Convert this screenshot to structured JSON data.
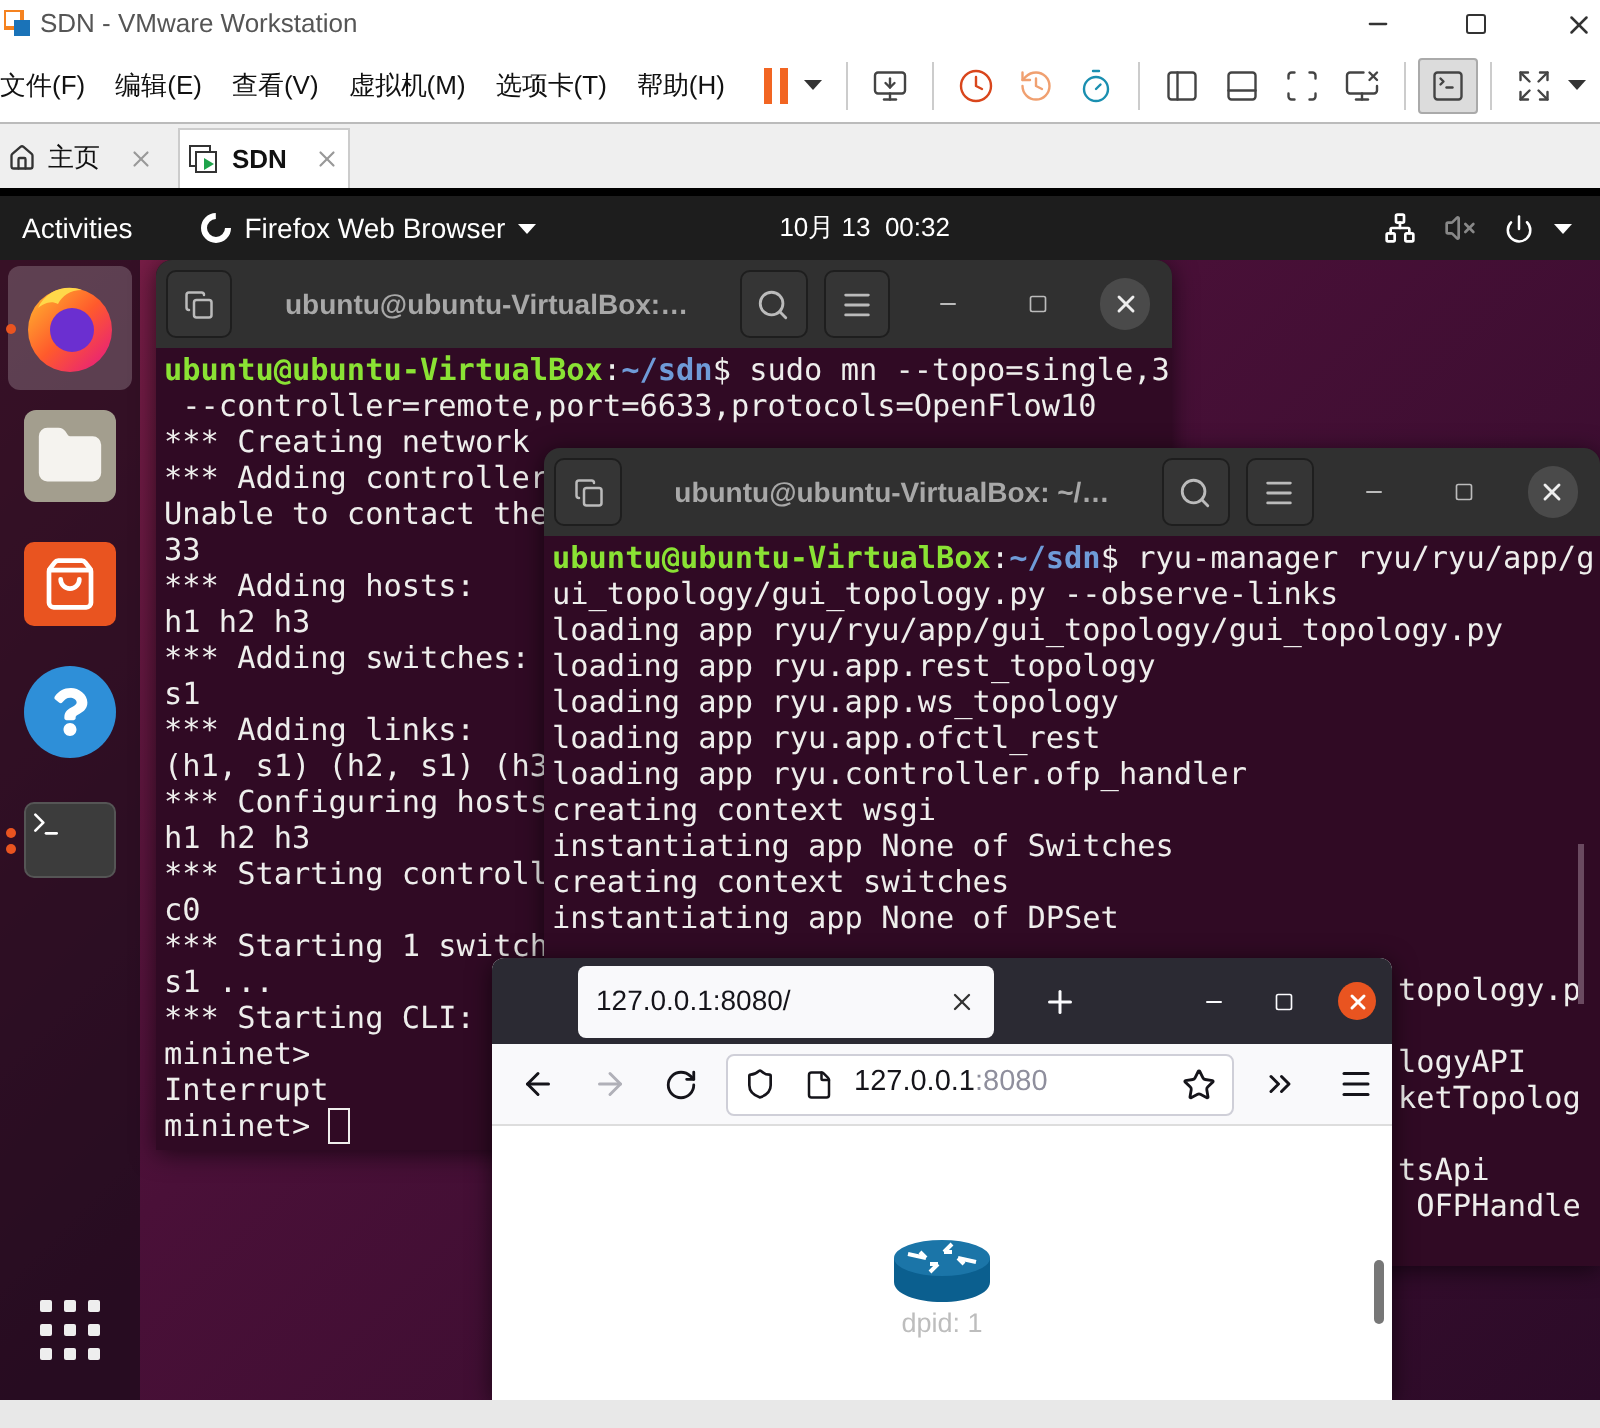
{
  "vmware": {
    "title": "SDN - VMware Workstation",
    "menu": [
      "文件(F)",
      "编辑(E)",
      "查看(V)",
      "虚拟机(M)",
      "选项卡(T)",
      "帮助(H)"
    ],
    "toolbar": [
      {
        "kind": "pause",
        "selected": false
      },
      {
        "kind": "send-keys",
        "selected": false
      },
      {
        "kind": "snapshot-take",
        "selected": false
      },
      {
        "kind": "snapshot-revert",
        "selected": false
      },
      {
        "kind": "snapshot-manager",
        "selected": false
      },
      {
        "kind": "library",
        "selected": false
      },
      {
        "kind": "thumbnails",
        "selected": false
      },
      {
        "kind": "full-screen",
        "selected": false
      },
      {
        "kind": "unity",
        "selected": false
      },
      {
        "kind": "console",
        "selected": true
      },
      {
        "kind": "stretch",
        "selected": false
      }
    ],
    "tabs": [
      {
        "label": "主页",
        "kind": "home",
        "selected": false
      },
      {
        "label": "SDN",
        "kind": "vm",
        "selected": true
      }
    ]
  },
  "ubuntu": {
    "activities": "Activities",
    "app_menu": "Firefox Web Browser",
    "clock": "10月 13  00:32",
    "sound_muted": true
  },
  "dock": [
    {
      "kind": "browser",
      "selected": true,
      "running": true,
      "multiple_windows": false
    },
    {
      "kind": "files",
      "selected": false,
      "running": false
    },
    {
      "kind": "software",
      "selected": false,
      "running": false
    },
    {
      "kind": "help",
      "selected": false,
      "running": false
    },
    {
      "kind": "terminal",
      "selected": false,
      "running": true,
      "multiple_windows": true
    }
  ],
  "terminals": [
    {
      "title": "ubuntu@ubuntu-VirtualBox:…",
      "cursor": true,
      "lines": [
        {
          "kind": "prompt",
          "segments": [
            {
              "kind": "user",
              "text": "ubuntu@ubuntu-VirtualBox"
            },
            {
              "kind": "plain",
              "text": ":"
            },
            {
              "kind": "path",
              "text": "~/sdn"
            },
            {
              "kind": "plain",
              "text": "$ sudo mn --topo=single,3"
            }
          ]
        },
        {
          "kind": "output",
          "text": " --controller=remote,port=6633,protocols=OpenFlow10"
        },
        {
          "kind": "output",
          "text": "*** Creating network"
        },
        {
          "kind": "output",
          "text": "*** Adding controller"
        },
        {
          "kind": "output",
          "text": "Unable to contact the"
        },
        {
          "kind": "output",
          "text": "33"
        },
        {
          "kind": "output",
          "text": "*** Adding hosts:"
        },
        {
          "kind": "output",
          "text": "h1 h2 h3"
        },
        {
          "kind": "output",
          "text": "*** Adding switches:"
        },
        {
          "kind": "output",
          "text": "s1"
        },
        {
          "kind": "output",
          "text": "*** Adding links:"
        },
        {
          "kind": "output",
          "text": "(h1, s1) (h2, s1) (h3"
        },
        {
          "kind": "output",
          "text": "*** Configuring hosts"
        },
        {
          "kind": "output",
          "text": "h1 h2 h3"
        },
        {
          "kind": "output",
          "text": "*** Starting controll"
        },
        {
          "kind": "output",
          "text": "c0"
        },
        {
          "kind": "output",
          "text": "*** Starting 1 switch"
        },
        {
          "kind": "output",
          "text": "s1 ..."
        },
        {
          "kind": "output",
          "text": "*** Starting CLI:"
        },
        {
          "kind": "output",
          "text": "mininet>"
        },
        {
          "kind": "output",
          "text": "Interrupt"
        },
        {
          "kind": "output",
          "text": "mininet>"
        }
      ]
    },
    {
      "title": "ubuntu@ubuntu-VirtualBox: ~/…",
      "cursor": false,
      "lines": [
        {
          "kind": "prompt",
          "segments": [
            {
              "kind": "user",
              "text": "ubuntu@ubuntu-VirtualBox"
            },
            {
              "kind": "plain",
              "text": ":"
            },
            {
              "kind": "path",
              "text": "~/sdn"
            },
            {
              "kind": "plain",
              "text": "$ ryu-manager ryu/ryu/app/g"
            }
          ]
        },
        {
          "kind": "output",
          "text": "ui_topology/gui_topology.py --observe-links"
        },
        {
          "kind": "output",
          "text": "loading app ryu/ryu/app/gui_topology/gui_topology.py"
        },
        {
          "kind": "output",
          "text": "loading app ryu.app.rest_topology"
        },
        {
          "kind": "output",
          "text": "loading app ryu.app.ws_topology"
        },
        {
          "kind": "output",
          "text": "loading app ryu.app.ofctl_rest"
        },
        {
          "kind": "output",
          "text": "loading app ryu.controller.ofp_handler"
        },
        {
          "kind": "output",
          "text": "creating context wsgi"
        },
        {
          "kind": "output",
          "text": "instantiating app None of Switches"
        },
        {
          "kind": "output",
          "text": "creating context switches"
        },
        {
          "kind": "output",
          "text": "instantiating app None of DPSet"
        },
        {
          "kind": "blank"
        },
        {
          "kind": "fragment",
          "text": "topology.p"
        },
        {
          "kind": "blank"
        },
        {
          "kind": "fragment",
          "text": "logyAPI"
        },
        {
          "kind": "fragment",
          "text": "ketTopolog"
        },
        {
          "kind": "blank"
        },
        {
          "kind": "fragment",
          "text": "tsApi"
        },
        {
          "kind": "fragment",
          "text": " OFPHandle"
        }
      ]
    }
  ],
  "browser": {
    "tab_title": "127.0.0.1:8080/",
    "address_host": "127.0.0.1",
    "address_port": ":8080",
    "forward_disabled": true,
    "node_label": "dpid: 1"
  }
}
